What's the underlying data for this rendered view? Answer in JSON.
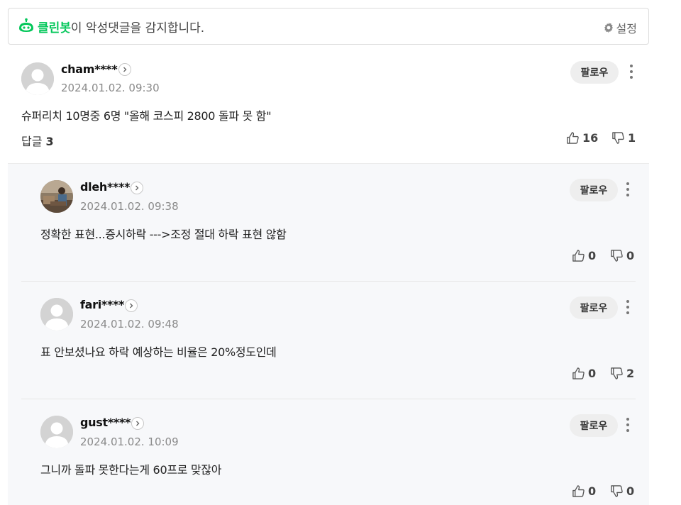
{
  "cleanbot": {
    "brand": "클린봇",
    "message": "이 악성댓글을 감지합니다.",
    "settings_label": "설정",
    "accent_color": "#03c75a"
  },
  "comment": {
    "nickname": "cham****",
    "date": "2024.01.02. 09:30",
    "text": "슈퍼리치 10명중 6명 \"올해 코스피 2800 돌파 못 함\"",
    "follow_label": "팔로우",
    "reply_label": "답글",
    "reply_count": "3",
    "likes": "16",
    "dislikes": "1"
  },
  "replies": [
    {
      "nickname": "dleh****",
      "date": "2024.01.02. 09:38",
      "text": "정확한 표현...증시하락 --->조정 절대 하락 표현 않함",
      "follow_label": "팔로우",
      "likes": "0",
      "dislikes": "0",
      "has_photo": true
    },
    {
      "nickname": "fari****",
      "date": "2024.01.02. 09:48",
      "text": "표 안보셨나요 하락 예상하는 비율은 20%정도인데",
      "follow_label": "팔로우",
      "likes": "0",
      "dislikes": "2",
      "has_photo": false
    },
    {
      "nickname": "gust****",
      "date": "2024.01.02. 10:09",
      "text": "그니까 돌파 못한다는게 60프로 맞잖아",
      "follow_label": "팔로우",
      "likes": "0",
      "dislikes": "0",
      "has_photo": false
    }
  ],
  "icons": {
    "cleanbot": "robot-icon",
    "settings": "gear-icon",
    "profile_link": "chevron-right-icon",
    "more": "more-vertical-icon",
    "like": "thumbs-up-icon",
    "dislike": "thumbs-down-icon"
  }
}
